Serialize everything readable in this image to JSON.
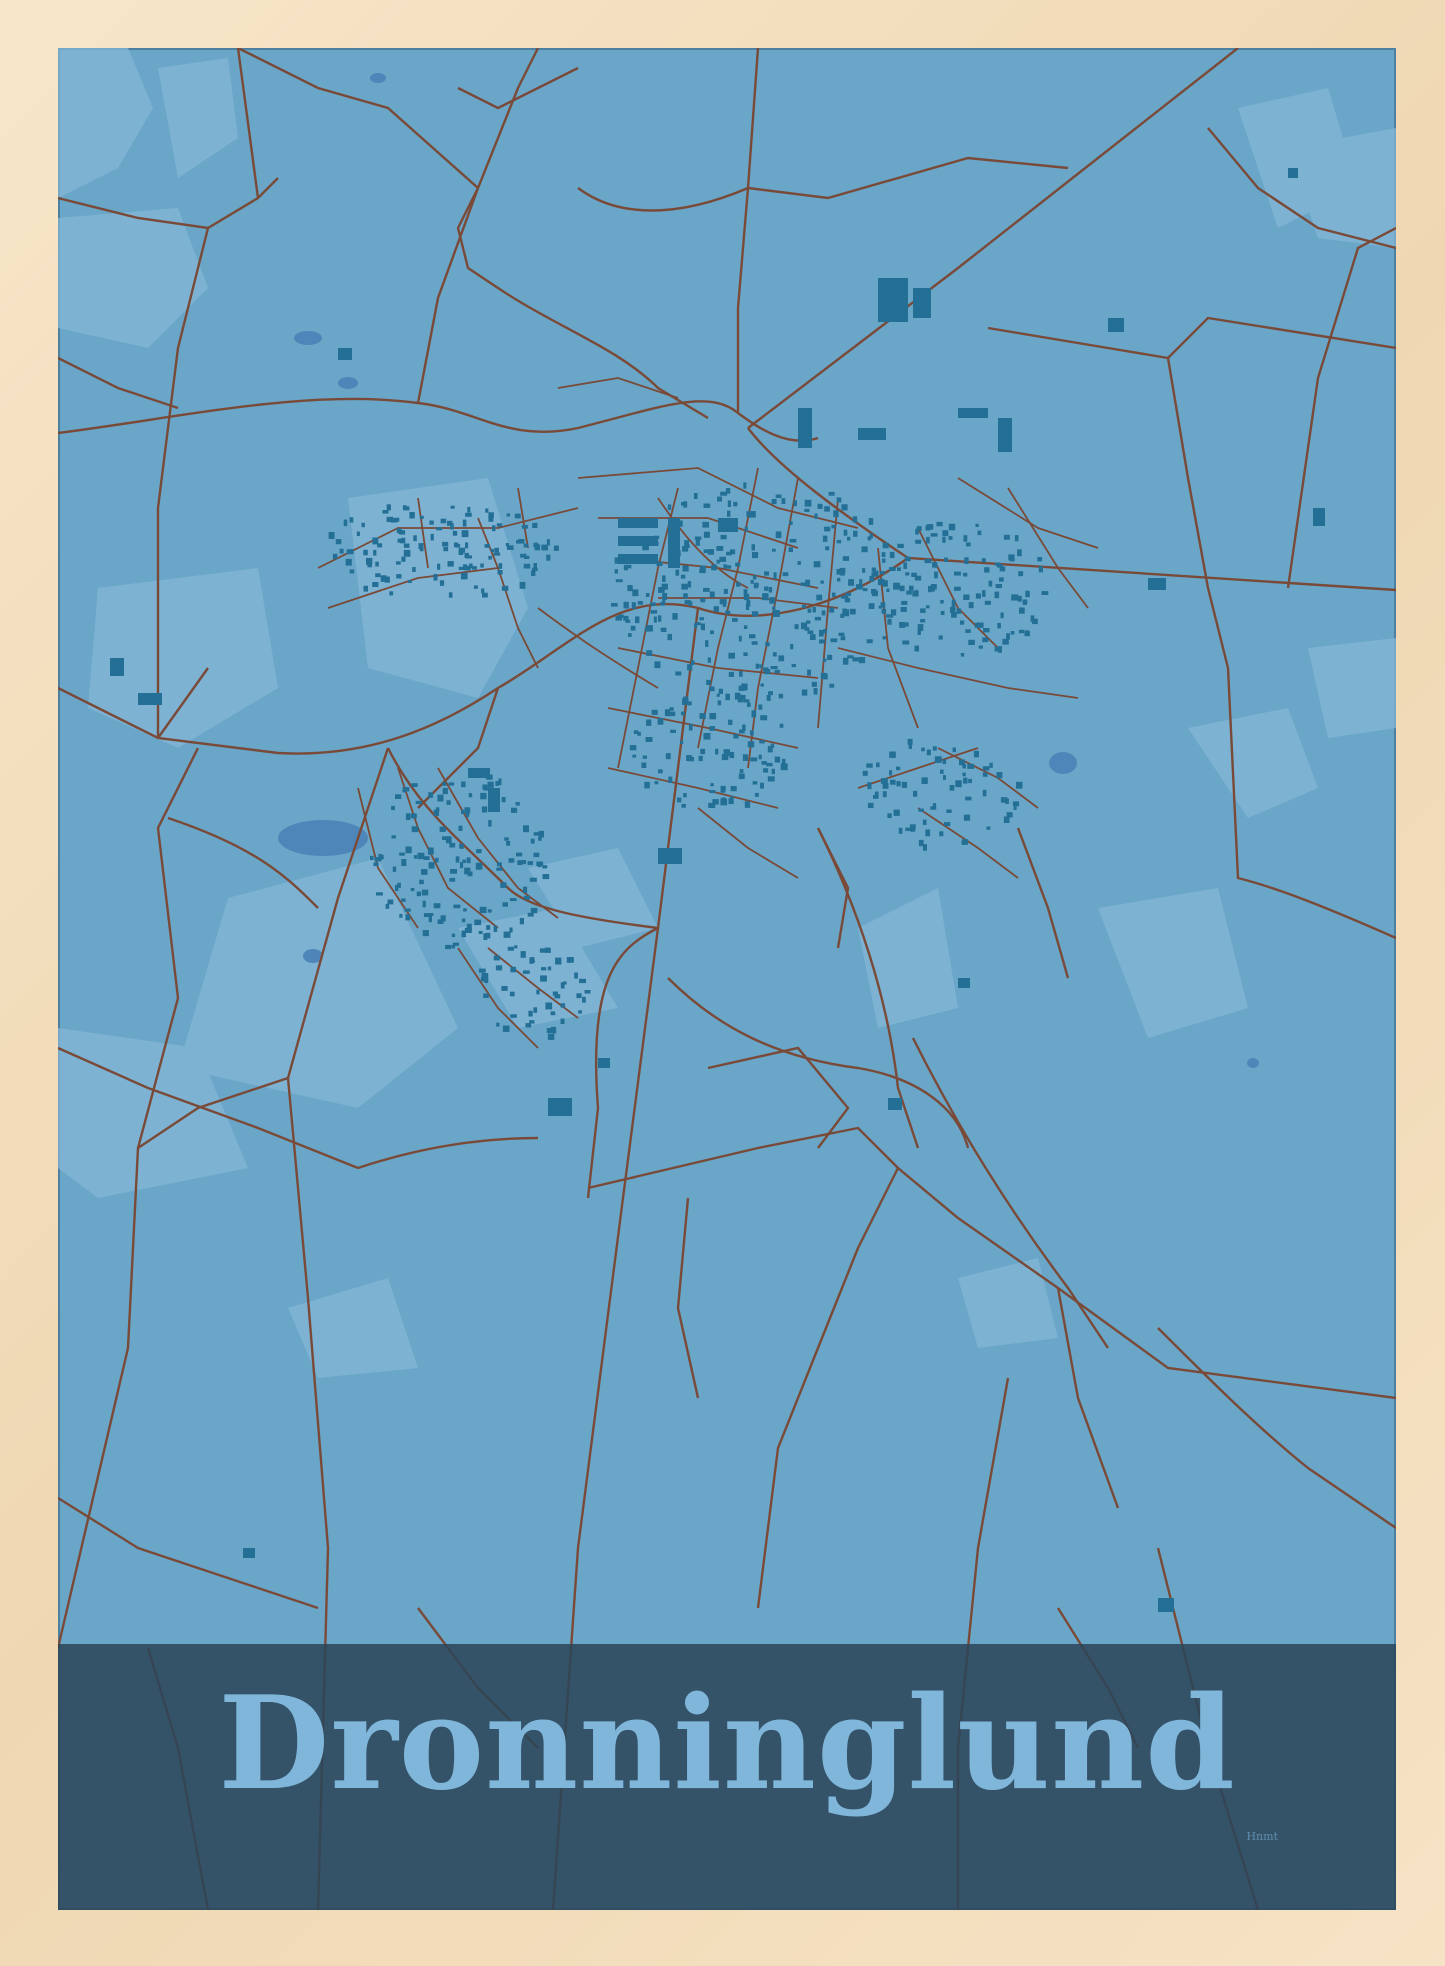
{
  "poster": {
    "title": "Dronninglund",
    "signature": "Hnmt",
    "colors": {
      "frame": "#f3dfc0",
      "land": "#6aa6c8",
      "fields_light": "#84b6d6",
      "water": "#4f86b9",
      "roads": "#7a4a38",
      "buildings": "#236f95",
      "band": "#2b4558",
      "title_text": "#7fb6da"
    },
    "icons": [
      "frame",
      "map",
      "title-band"
    ]
  }
}
